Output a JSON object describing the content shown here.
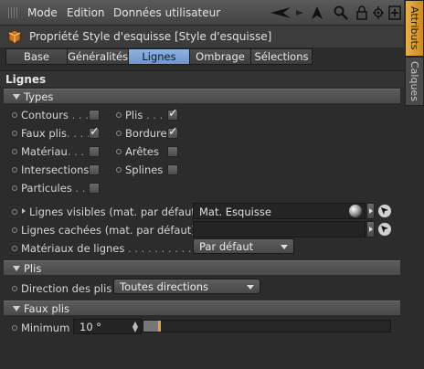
{
  "menubar": {
    "items": [
      "Mode",
      "Edition",
      "Données utilisateur"
    ]
  },
  "object": {
    "title": "Propriété Style d'esquisse [Style d'esquisse]"
  },
  "tabs": [
    {
      "label": "Base",
      "active": false
    },
    {
      "label": "Généralités",
      "active": false
    },
    {
      "label": "Lignes",
      "active": true
    },
    {
      "label": "Ombrage",
      "active": false
    },
    {
      "label": "Sélections",
      "active": false
    }
  ],
  "section": {
    "title": "Lignes"
  },
  "types": {
    "header": "Types",
    "items": [
      {
        "label": "Contours",
        "leader": " . . .",
        "checked": false
      },
      {
        "label": "Plis",
        "leader": " . . .",
        "checked": true
      },
      {
        "label": "Faux plis",
        "leader": ". . . .",
        "checked": true
      },
      {
        "label": "Bordure",
        "leader": "",
        "checked": true
      },
      {
        "label": "Matériau",
        "leader": ". . . .",
        "checked": false
      },
      {
        "label": "Arêtes",
        "leader": "",
        "checked": false
      },
      {
        "label": "Intersections",
        "leader": "",
        "checked": false
      },
      {
        "label": "Splines",
        "leader": "",
        "checked": false
      },
      {
        "label": "Particules",
        "leader": " . . .",
        "checked": false
      }
    ],
    "check_glyph": "✓"
  },
  "links": {
    "visible_label": "Lignes visibles (mat. par défaut)",
    "visible_value": "Mat. Esquisse",
    "hidden_label": "Lignes cachées (mat. par défaut)",
    "hidden_value": "",
    "materials_label": "Matériaux de lignes",
    "materials_leader": " . . . . . . . . . . . . .",
    "materials_value": "Par défaut"
  },
  "plis": {
    "header": "Plis",
    "direction_label": "Direction des plis",
    "direction_value": "Toutes directions"
  },
  "faux_plis": {
    "header": "Faux plis",
    "minimum_label": "Minimum",
    "minimum_value": "10 °",
    "slider_fraction": 0.06
  },
  "sidebar": {
    "tabs": [
      {
        "label": "Attributs",
        "active": true
      },
      {
        "label": "Calques",
        "active": false
      }
    ]
  },
  "colors": {
    "accent": "#7ea6db",
    "attributes_tab": "#e0a53c",
    "slider_knob": "#e8a23a"
  }
}
